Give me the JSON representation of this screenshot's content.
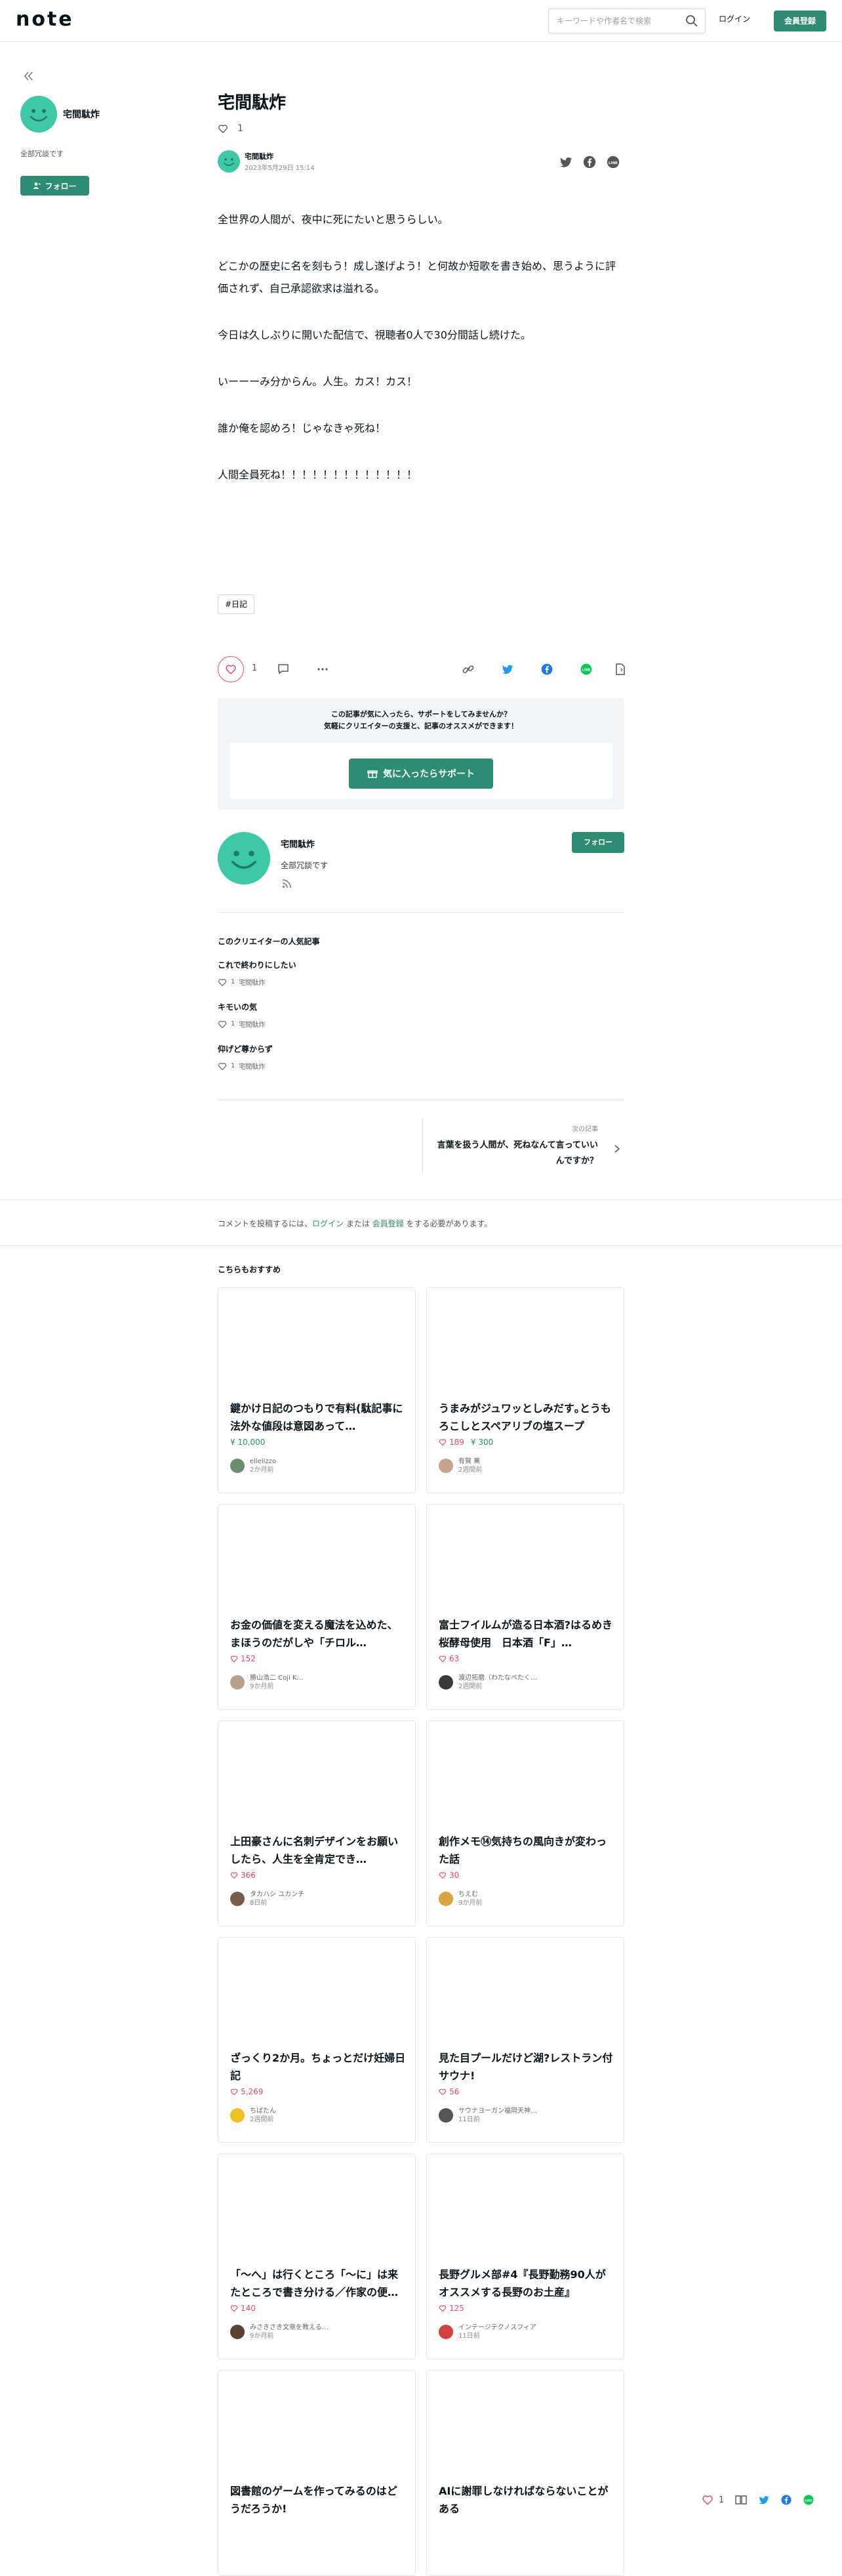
{
  "header": {
    "logo": "note",
    "search_placeholder": "キーワードや作者名で検索",
    "login": "ログイン",
    "signup": "会員登録"
  },
  "sidebar": {
    "creator_name": "宅間駄炸",
    "bio": "全部冗談です",
    "follow": "フォロー"
  },
  "article": {
    "title": "宅間駄炸",
    "like_count": "1",
    "author": "宅間駄炸",
    "date": "2023年5月29日 15:14",
    "paragraphs": [
      "全世界の人間が、夜中に死にたいと思うらしい。",
      "どこかの歴史に名を刻もう！成し遂げよう！と何故か短歌を書き始め、思うように評価されず、自己承認欲求は溢れる。",
      "今日は久しぶりに開いた配信で、視聴者0人で30分間話し続けた。",
      "いーーーみ分からん。人生。カス！カス！",
      "誰か俺を認めろ！じゃなきゃ死ね！",
      "人間全員死ね！！！！！！！！！！！！！"
    ],
    "tag": "#日記",
    "actions_like_count": "1"
  },
  "support": {
    "line1": "この記事が気に入ったら、サポートをしてみませんか？",
    "line2": "気軽にクリエイターの支援と、記事のオススメができます！",
    "button": "気に入ったらサポート"
  },
  "creator": {
    "name": "宅間駄炸",
    "bio": "全部冗談です",
    "follow": "フォロー"
  },
  "popular": {
    "heading": "このクリエイターの人気記事",
    "items": [
      {
        "title": "これで終わりにしたい",
        "likes": "1",
        "author": "宅間駄炸"
      },
      {
        "title": "キモいの気",
        "likes": "1",
        "author": "宅間駄炸"
      },
      {
        "title": "仰げど尊からず",
        "likes": "1",
        "author": "宅間駄炸"
      }
    ]
  },
  "next": {
    "label": "次の記事",
    "title": "言葉を扱う人間が、死ねなんて言っていいんですか？"
  },
  "comment": {
    "prefix": "コメントを投稿するには、",
    "login": "ログイン",
    "middle": " または ",
    "signup": "会員登録",
    "suffix": " をする必要があります。"
  },
  "recommend": {
    "heading": "こちらもおすすめ",
    "cards": [
      {
        "title": "鍵かけ日記のつもりで有料(駄記事に法外な値段は意図あって…",
        "price": "¥ 10,000",
        "likes": "",
        "user": "ellelizzo",
        "time": "2か月前",
        "avatar_color": "#6b8c6f"
      },
      {
        "title": "うまみがジュワッとしみだす｡とうもろこしとスペアリブの塩スープ",
        "price": "¥ 300",
        "likes": "189",
        "user": "有賀 薫",
        "time": "2週間前",
        "avatar_color": "#c9a08a"
      },
      {
        "title": "お金の価値を変える魔法を込めた、まほうのだがしや「チロル…",
        "price": "",
        "likes": "152",
        "user": "勝山浩二 Coji K…",
        "time": "9か月前",
        "avatar_color": "#b8a08a"
      },
      {
        "title": "富士フイルムが造る日本酒?はるめき桜酵母使用　日本酒「F」…",
        "price": "",
        "likes": "63",
        "user": "渡辺拓磨（わたなべたく…",
        "time": "2週間前",
        "avatar_color": "#3a3a3a"
      },
      {
        "title": "上田豪さんに名刺デザインをお願いしたら、人生を全肯定でき…",
        "price": "",
        "likes": "366",
        "user": "タカハシ ユカンチ",
        "time": "8日前",
        "avatar_color": "#7a5a4a"
      },
      {
        "title": "創作メモ⑭気持ちの風向きが変わった話",
        "price": "",
        "likes": "30",
        "user": "ちえむ",
        "time": "9か月前",
        "avatar_color": "#d9a441"
      },
      {
        "title": "ざっくり2か月。ちょっとだけ妊婦日記",
        "price": "",
        "likes": "5,269",
        "user": "ちばたん",
        "time": "2週間前",
        "avatar_color": "#f0c020"
      },
      {
        "title": "見た目プールだけど湖?レストラン付サウナ!",
        "price": "",
        "likes": "56",
        "user": "サウナヨーガン福岡天神…",
        "time": "11日前",
        "avatar_color": "#555555"
      },
      {
        "title": "「～へ」は行くところ「～に」は来たところで書き分ける／作家の便…",
        "price": "",
        "likes": "140",
        "user": "みさきさき文章を教える…",
        "time": "9か月前",
        "avatar_color": "#5a4030"
      },
      {
        "title": "長野グルメ部#4『長野勤務90人がオススメする長野のお土産』",
        "price": "",
        "likes": "125",
        "user": "インテージテクノスフィア",
        "time": "11日前",
        "avatar_color": "#d04040"
      },
      {
        "title": "図書館のゲームを作ってみるのはどうだろうか!",
        "price": "",
        "likes": "",
        "user": "",
        "time": "",
        "avatar_color": "#cccccc"
      },
      {
        "title": "AIに謝罪しなければならないことがある",
        "price": "",
        "likes": "",
        "user": "",
        "time": "",
        "avatar_color": "#cccccc"
      }
    ]
  },
  "float_bar": {
    "like_count": "1"
  },
  "colors": {
    "accent": "#2d8a73",
    "like": "#e8496a",
    "avatar": "#3ec8a8"
  }
}
